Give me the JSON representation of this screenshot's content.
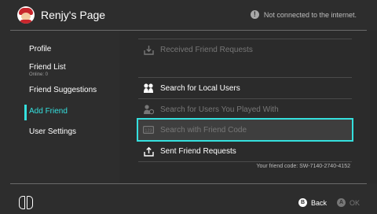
{
  "header": {
    "title": "Renjy's Page",
    "status_icon": "info-icon",
    "status_text": "Not connected to the internet."
  },
  "sidebar": {
    "items": [
      {
        "label": "Profile"
      },
      {
        "label": "Friend List",
        "sublabel": "Online: 0"
      },
      {
        "label": "Friend Suggestions"
      },
      {
        "label": "Add Friend",
        "active": true
      },
      {
        "label": "User Settings"
      }
    ]
  },
  "main": {
    "rows": [
      {
        "label": "Received Friend Requests",
        "icon": "inbox-icon",
        "disabled": true
      },
      {
        "label": "Search for Local Users",
        "icon": "local-users-icon",
        "disabled": false
      },
      {
        "label": "Search for Users You Played With",
        "icon": "played-with-icon",
        "disabled": true
      },
      {
        "label": "Search with Friend Code",
        "icon": "friend-code-icon",
        "disabled": true,
        "selected": true
      },
      {
        "label": "Sent Friend Requests",
        "icon": "outbox-icon",
        "disabled": false
      }
    ],
    "friend_code": "Your friend code: SW-7140-2740-4152"
  },
  "footer": {
    "controller_icon": "joycon-icon",
    "back": {
      "button": "B",
      "label": "Back"
    },
    "ok": {
      "button": "A",
      "label": "OK"
    }
  },
  "colors": {
    "accent": "#35e0de",
    "background": "#2d2d2d",
    "disabled_text": "#777777"
  }
}
